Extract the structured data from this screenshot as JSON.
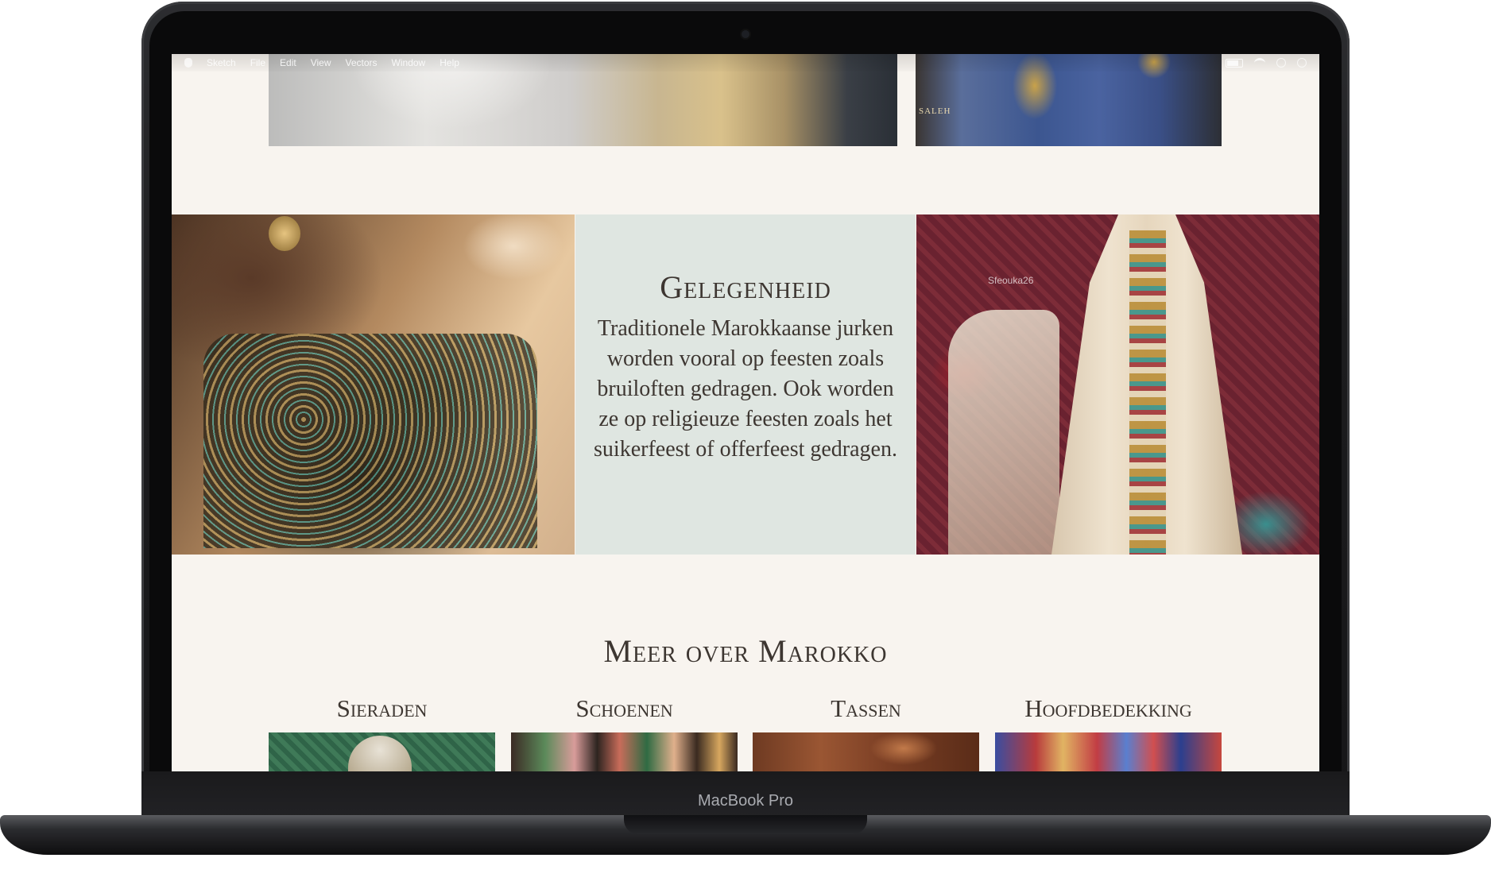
{
  "device": {
    "label": "MacBook Pro"
  },
  "menubar": {
    "items": [
      "Sketch",
      "File",
      "Edit",
      "View",
      "Vectors",
      "Window",
      "Help"
    ],
    "icons": [
      "apple-icon",
      "battery-icon",
      "wifi-icon",
      "search-icon",
      "control-center-icon"
    ]
  },
  "top_images": {
    "second_watermark": "SALEH"
  },
  "occasion": {
    "title": "Gelegenheid",
    "body": "Traditionele Marokkaanse jurken worden vooral op feesten zoals bruiloften gedragen. Ook worden ze op religieuze feesten zoals het suikerfeest of offerfeest gedragen.",
    "right_watermark": "Sfeouka26"
  },
  "more": {
    "title": "Meer over Marokko",
    "categories": [
      {
        "label": "Sieraden"
      },
      {
        "label": "Schoenen"
      },
      {
        "label": "Tassen"
      },
      {
        "label": "Hoofdbedekking"
      }
    ]
  },
  "colors": {
    "page_background": "#f8f4ef",
    "occasion_panel": "#dfe6e1",
    "text": "#3d3631",
    "laptop_body": "#1c1c1e"
  }
}
